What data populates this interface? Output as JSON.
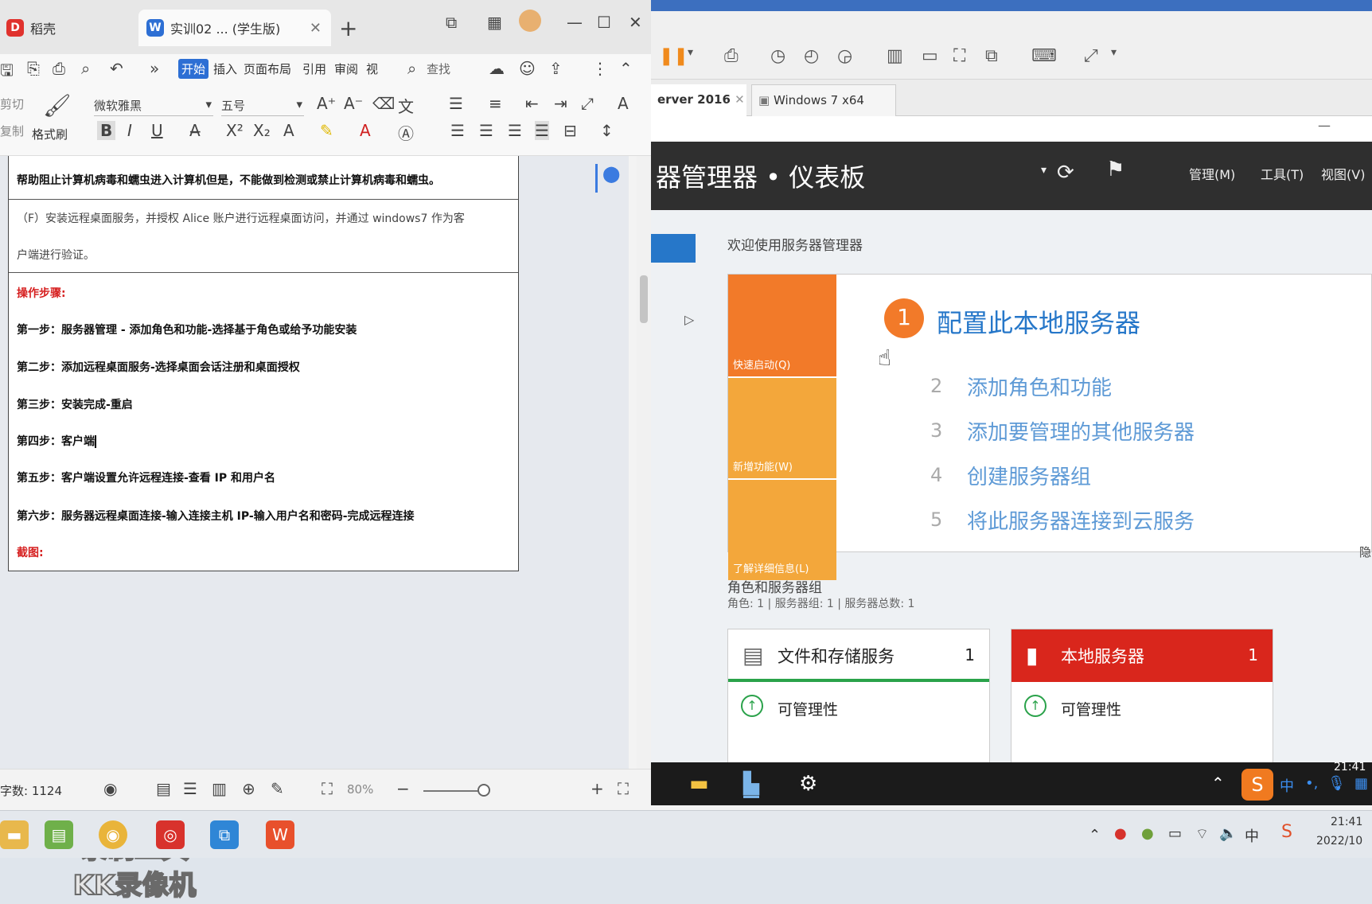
{
  "wps": {
    "tabs": [
      {
        "label": "稻壳",
        "icon": "daoke-icon"
      },
      {
        "label": "实训02 ... (学生版)",
        "icon": "wps-writer-icon"
      }
    ],
    "menu": [
      "开始",
      "插入",
      "页面布局",
      "引用",
      "审阅",
      "视"
    ],
    "search_label": "查找",
    "font_name": "微软雅黑",
    "font_size": "五号",
    "format_painter": "格式刷",
    "clip_labels": [
      "剪切",
      "复制"
    ],
    "doc": {
      "line1": "帮助阻止计算机病毒和蠕虫进入计算机但是，不能做到检测或禁止计算机病毒和蠕虫。",
      "task_line1": "（F）安装远程桌面服务，并授权 Alice 账户进行远程桌面访问，并通过 windows7 作为客",
      "task_line2": "户端进行验证。",
      "steps_title": "操作步骤:",
      "steps": [
        "第一步：服务器管理 - 添加角色和功能-选择基于角色或给予功能安装",
        "第二步：添加远程桌面服务-选择桌面会话注册和桌面授权",
        "第三步：安装完成-重启",
        "第四步：客户端",
        "第五步：客户端设置允许远程连接-查看 IP 和用户名",
        "第六步：服务器远程桌面连接-输入连接主机 IP-输入用户名和密码-完成远程连接"
      ],
      "screenshot_label": "截图:"
    },
    "watermark": [
      "录制工具",
      "KK录像机"
    ],
    "status": {
      "word_count": "字数: 1124",
      "zoom": "80%"
    }
  },
  "vm": {
    "tabs": [
      "erver 2016",
      "Windows 7 x64"
    ],
    "server_manager": {
      "title": "器管理器 • 仪表板",
      "menus": [
        "管理(M)",
        "工具(T)",
        "视图(V)"
      ],
      "welcome": "欢迎使用服务器管理器",
      "quick_start_blocks": [
        "快速启动(Q)",
        "新增功能(W)",
        "了解详细信息(L)"
      ],
      "step1_num": "1",
      "step1": "配置此本地服务器",
      "steps": [
        {
          "n": "2",
          "t": "添加角色和功能"
        },
        {
          "n": "3",
          "t": "添加要管理的其他服务器"
        },
        {
          "n": "4",
          "t": "创建服务器组"
        },
        {
          "n": "5",
          "t": "将此服务器连接到云服务"
        }
      ],
      "hide_label": "隐",
      "roles_title": "角色和服务器组",
      "roles_sub": "角色: 1 | 服务器组: 1 | 服务器总数: 1",
      "tiles": [
        {
          "name": "文件和存储服务",
          "count": "1",
          "status": "可管理性",
          "color": "#ffffff"
        },
        {
          "name": "本地服务器",
          "count": "1",
          "status": "可管理性",
          "color": "#d9261c"
        }
      ]
    },
    "guest_clock": "21:41",
    "guest_ime": "中"
  },
  "host": {
    "clock_time": "21:41",
    "clock_date": "2022/10"
  },
  "colors": {
    "accent": "#2677c9",
    "orange": "#f27a29",
    "red_tile": "#d9261c",
    "wps_blue": "#2d6fd4"
  }
}
